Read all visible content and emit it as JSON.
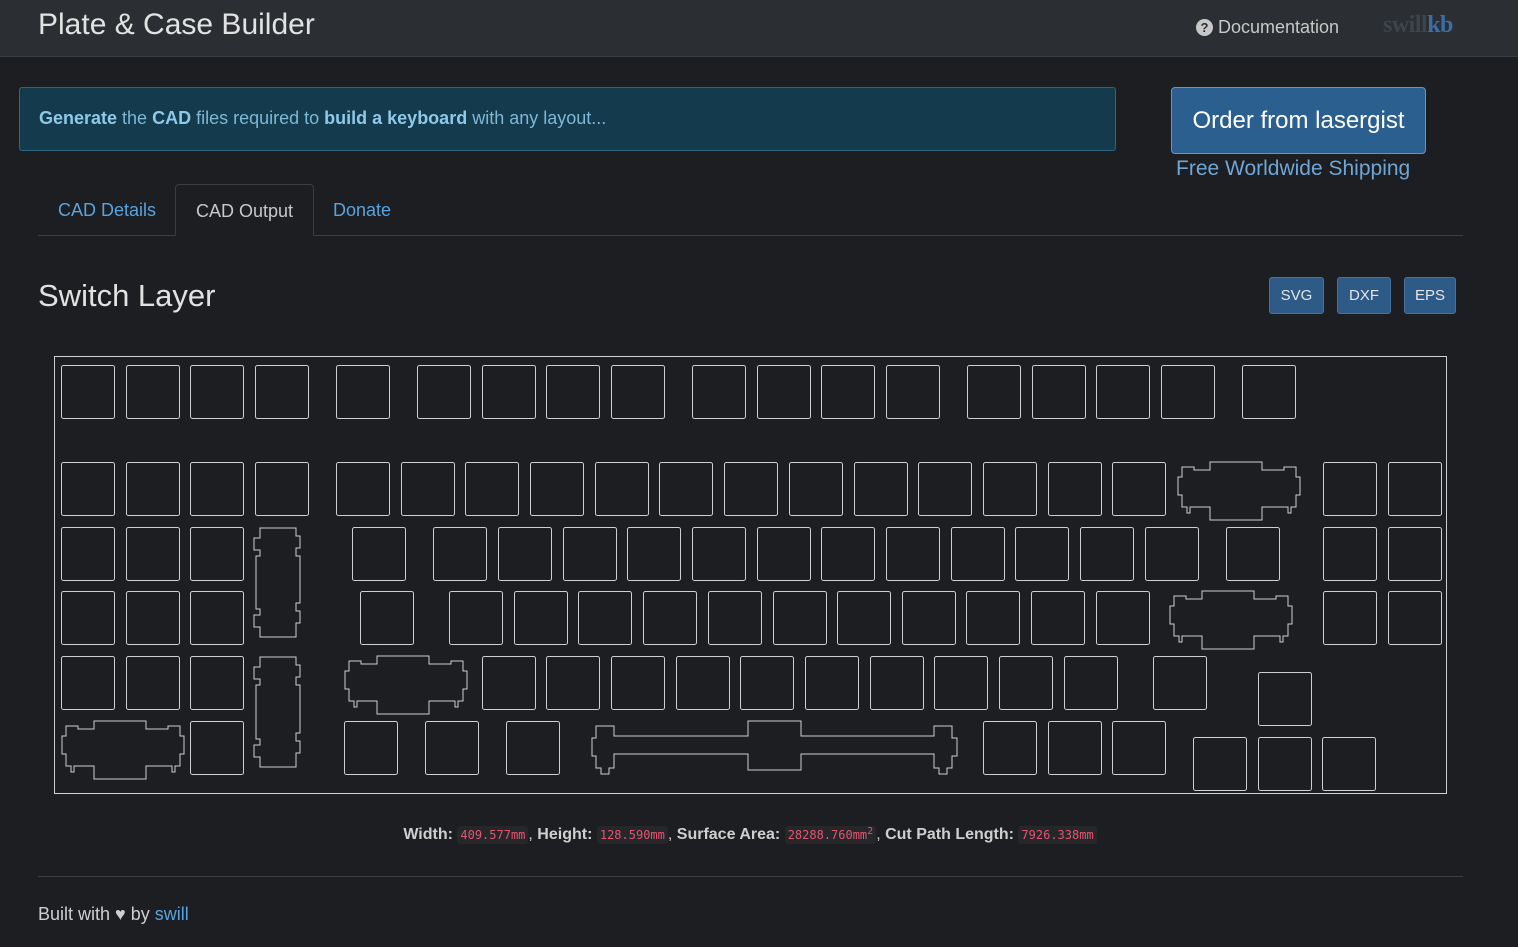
{
  "header": {
    "title": "Plate & Case Builder",
    "documentation_label": "Documentation",
    "help_icon": "question-circle-icon",
    "brand_part1": "swill",
    "brand_part2": "kb"
  },
  "banner": {
    "word1": "Generate",
    "word2": " the ",
    "word3": "CAD",
    "word4": " files required to ",
    "word5": "build a keyboard",
    "word6": " with any layout..."
  },
  "order": {
    "button_label": "Order from lasergist",
    "shipping_note": "Free Worldwide Shipping"
  },
  "tabs": [
    {
      "label": "CAD Details",
      "active": false
    },
    {
      "label": "CAD Output",
      "active": true
    },
    {
      "label": "Donate",
      "active": false
    }
  ],
  "output": {
    "section_title": "Switch Layer",
    "formats": [
      "SVG",
      "DXF",
      "EPS"
    ]
  },
  "stats": {
    "width_label": "Width:",
    "width_value": "409.577mm",
    "height_label": "Height:",
    "height_value": "128.590mm",
    "area_label": "Surface Area:",
    "area_value": "28288.760mm",
    "area_unit_sup": "2",
    "cut_label": "Cut Path Length:",
    "cut_value": "7926.338mm"
  },
  "footer": {
    "built_with": "Built with",
    "heart_icon": "heart-icon",
    "by": "by",
    "author": "swill"
  },
  "colors": {
    "background": "#1c1e21",
    "link": "#58a3e0",
    "button": "#2d5a86",
    "code": "#e8546e",
    "plate_stroke": "#cfcfcf"
  }
}
